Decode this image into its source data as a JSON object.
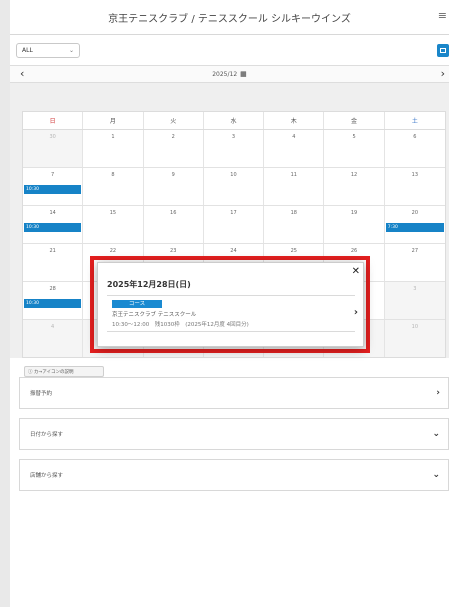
{
  "header": {
    "title": "京王テニスクラブ / テニススクール シルキーウインズ",
    "menu_icon": "≡"
  },
  "filter": {
    "selected": "ALL",
    "chevron": "⌄"
  },
  "month_nav": {
    "prev": "‹",
    "label": "2025/12",
    "calendar_icon": "▦",
    "next": "›"
  },
  "calendar": {
    "weekdays": [
      "日",
      "月",
      "火",
      "水",
      "木",
      "金",
      "土"
    ],
    "weeks": [
      [
        "30",
        "1",
        "2",
        "3",
        "4",
        "5",
        "6"
      ],
      [
        "7",
        "8",
        "9",
        "10",
        "11",
        "12",
        "13"
      ],
      [
        "14",
        "15",
        "16",
        "17",
        "18",
        "19",
        "20"
      ],
      [
        "21",
        "22",
        "23",
        "24",
        "25",
        "26",
        "27"
      ],
      [
        "28",
        "",
        "",
        "",
        "",
        "",
        "3"
      ],
      [
        "4",
        "",
        "",
        "",
        "",
        "",
        "10"
      ]
    ],
    "events": {
      "w1_sun": "10:30",
      "w2_sun": "10:30",
      "w2_sat": "7:30",
      "w4_sun": "10:30"
    }
  },
  "legend_button": "ⓘ カ→アイコンの説明",
  "accordions": [
    {
      "label": "振替予約",
      "chevron": "›"
    },
    {
      "label": "日付から探す",
      "chevron": "⌄"
    },
    {
      "label": "店舗から探す",
      "chevron": "⌄"
    }
  ],
  "popup": {
    "close": "✕",
    "date": "2025年12月28日(日)",
    "badge": "コース",
    "course": "京王テニスクラブ テニススクール",
    "detail": "10:30〜12:00　残1030枠　(2025年12月度 4回目分)",
    "arrow": "›"
  },
  "colors": {
    "accent": "#1683c7",
    "highlight": "#e41f1f",
    "sunday": "#d23c3c",
    "saturday": "#2f6fc6"
  }
}
